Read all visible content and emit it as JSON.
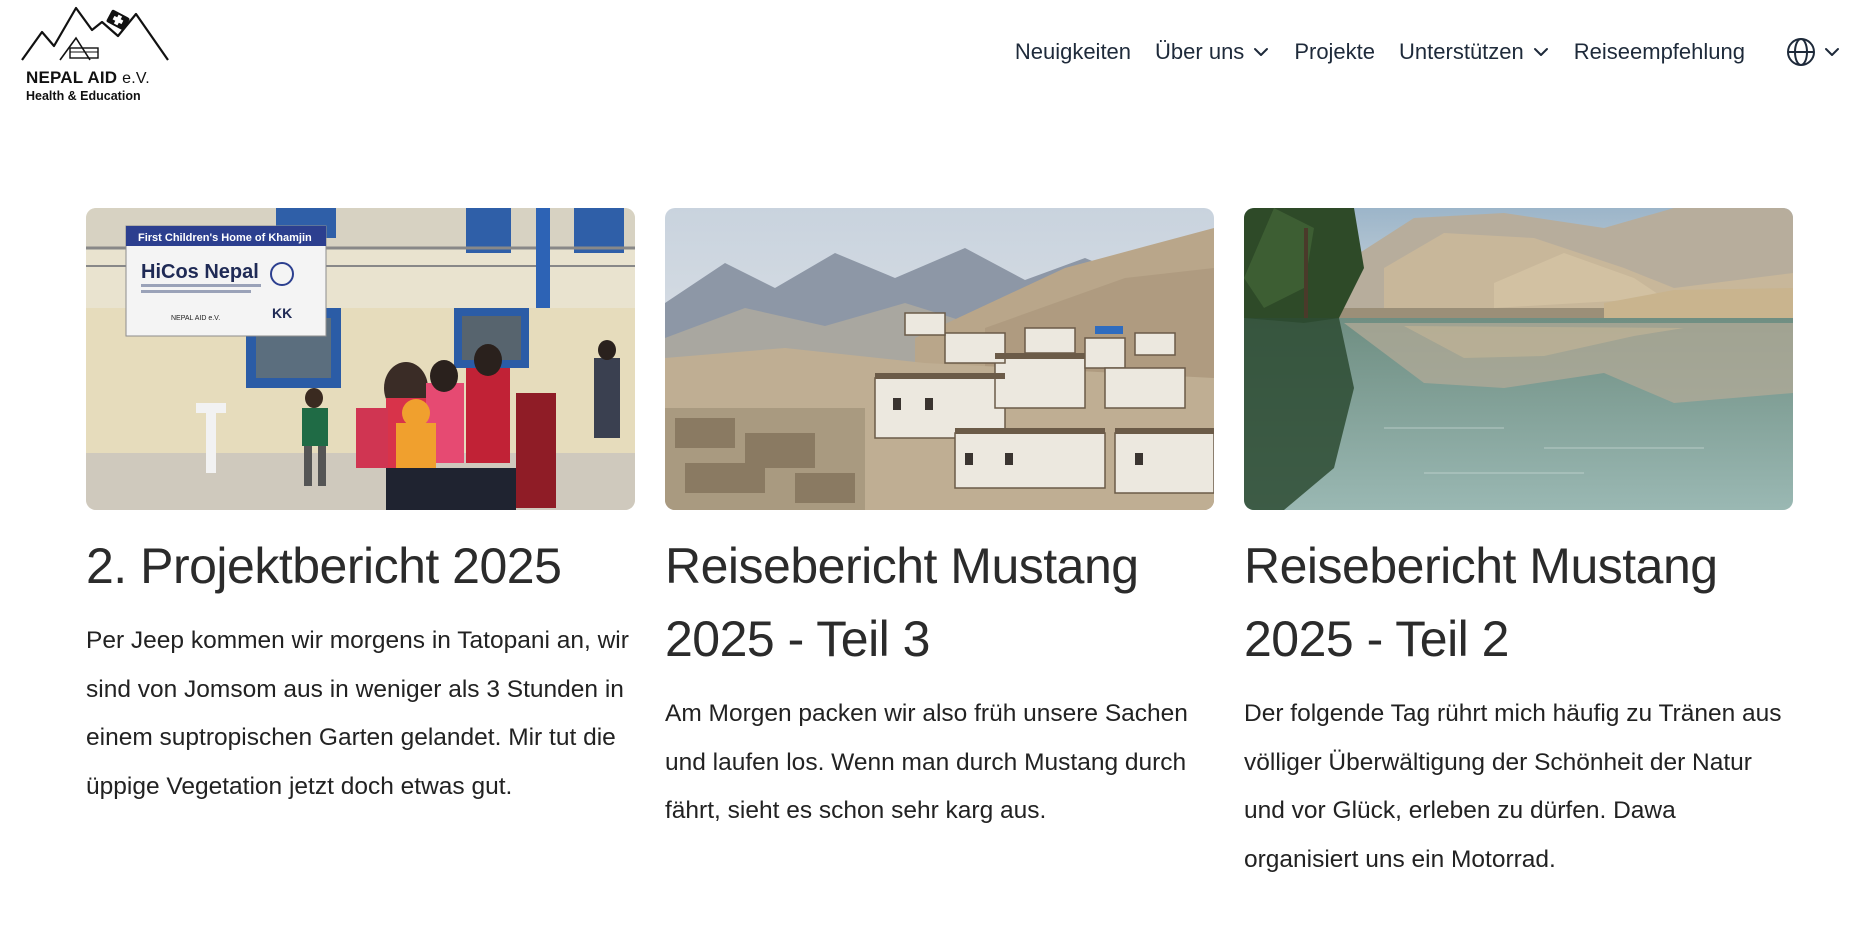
{
  "brand": {
    "name": "NEPAL AID",
    "suffix": "e.V.",
    "tagline": "Health & Education"
  },
  "nav": {
    "items": [
      {
        "label": "Neuigkeiten",
        "has_dropdown": false
      },
      {
        "label": "Über uns",
        "has_dropdown": true
      },
      {
        "label": "Projekte",
        "has_dropdown": false
      },
      {
        "label": "Unterstützen",
        "has_dropdown": true
      },
      {
        "label": "Reiseempfehlung",
        "has_dropdown": false
      }
    ],
    "language_icon": "globe-icon"
  },
  "posts": [
    {
      "title": "2. Projektbericht 2025",
      "excerpt": "Per Jeep kommen wir morgens in Tatopani an, wir sind von Jomsom aus in weniger als 3 Stunden in einem suptropischen Garten gelandet. Mir tut die üppige Vegetation jetzt doch etwas gut.",
      "image": {
        "banner_line1": "First Children's Home of Khamjin",
        "banner_line2": "HiCos Nepal",
        "banner_logo": "NEPAL AID e.V.",
        "banner_logo2": "KK"
      }
    },
    {
      "title": "Reisebericht Mustang 2025 - Teil 3",
      "excerpt": "Am Morgen packen wir also früh unsere Sachen und laufen los. Wenn man durch Mustang durch fährt, sieht es schon sehr karg aus."
    },
    {
      "title": "Reisebericht Mustang 2025 - Teil 2",
      "excerpt": "Der folgende Tag rührt mich häufig zu Tränen aus völliger Überwältigung der Schönheit der Natur und vor Glück, erleben zu dürfen. Dawa organisiert uns ein Motorrad."
    }
  ],
  "colors": {
    "text": "#2b2b2b",
    "nav_text": "#1e2a3a",
    "background": "#ffffff"
  }
}
